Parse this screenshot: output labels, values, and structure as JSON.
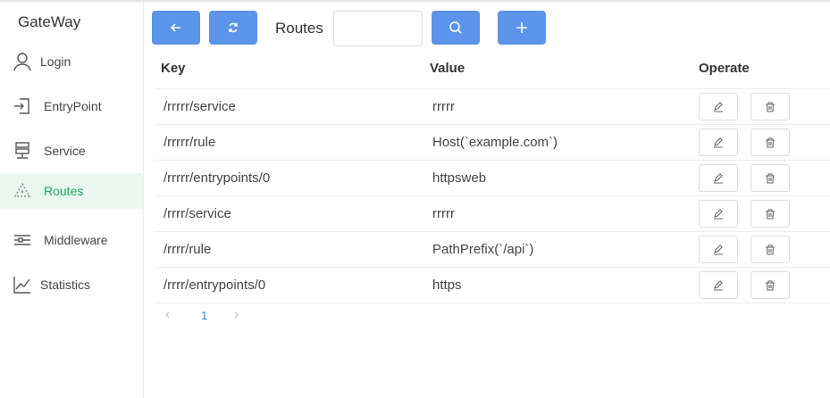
{
  "sidebar": {
    "brand": "GateWay",
    "items": [
      {
        "label": "Login",
        "icon": "user-icon"
      },
      {
        "label": "EntryPoint",
        "icon": "login-door-icon"
      },
      {
        "label": "Service",
        "icon": "server-icon"
      },
      {
        "label": "Routes",
        "icon": "network-icon",
        "active": true
      },
      {
        "label": "Middleware",
        "icon": "sliders-icon"
      },
      {
        "label": "Statistics",
        "icon": "line-chart-icon"
      }
    ]
  },
  "toolbar": {
    "back_icon": "arrow-left-icon",
    "refresh_icon": "refresh-icon",
    "label": "Routes",
    "search_value": "",
    "search_placeholder": "",
    "search_icon": "search-icon",
    "add_icon": "plus-icon"
  },
  "table": {
    "headers": {
      "key": "Key",
      "value": "Value",
      "operate": "Operate"
    },
    "rows": [
      {
        "key": "/rrrrr/service",
        "value": "rrrrr"
      },
      {
        "key": "/rrrrr/rule",
        "value": "Host(`example.com`)"
      },
      {
        "key": "/rrrrr/entrypoints/0",
        "value": "httpsweb"
      },
      {
        "key": "/rrrr/service",
        "value": "rrrrr"
      },
      {
        "key": "/rrrr/rule",
        "value": "PathPrefix(`/api`)"
      },
      {
        "key": "/rrrr/entrypoints/0",
        "value": "https"
      }
    ]
  },
  "pagination": {
    "prev": "‹",
    "current": "1",
    "next": "›"
  },
  "colors": {
    "accent": "#5b94e8",
    "active_text": "#1fa463",
    "active_bg": "#eaf7ee"
  }
}
